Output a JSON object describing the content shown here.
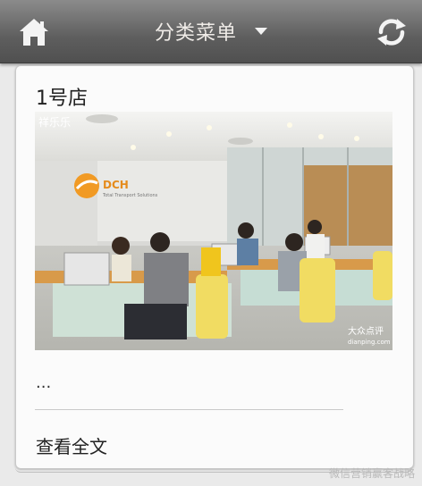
{
  "header": {
    "menu_title": "分类菜单",
    "home_icon": "home-icon",
    "refresh_icon": "refresh-icon"
  },
  "article": {
    "title": "1号店",
    "excerpt": "...",
    "read_more": "查看全文",
    "photo": {
      "brand_top": "祥乐乐",
      "logo_text": "DCH",
      "logo_sub": "Total Transport Solutions",
      "watermark_cn": "大众点评",
      "watermark_url": "dianping.com"
    }
  },
  "footer_watermark": "微信营销赢客战略"
}
